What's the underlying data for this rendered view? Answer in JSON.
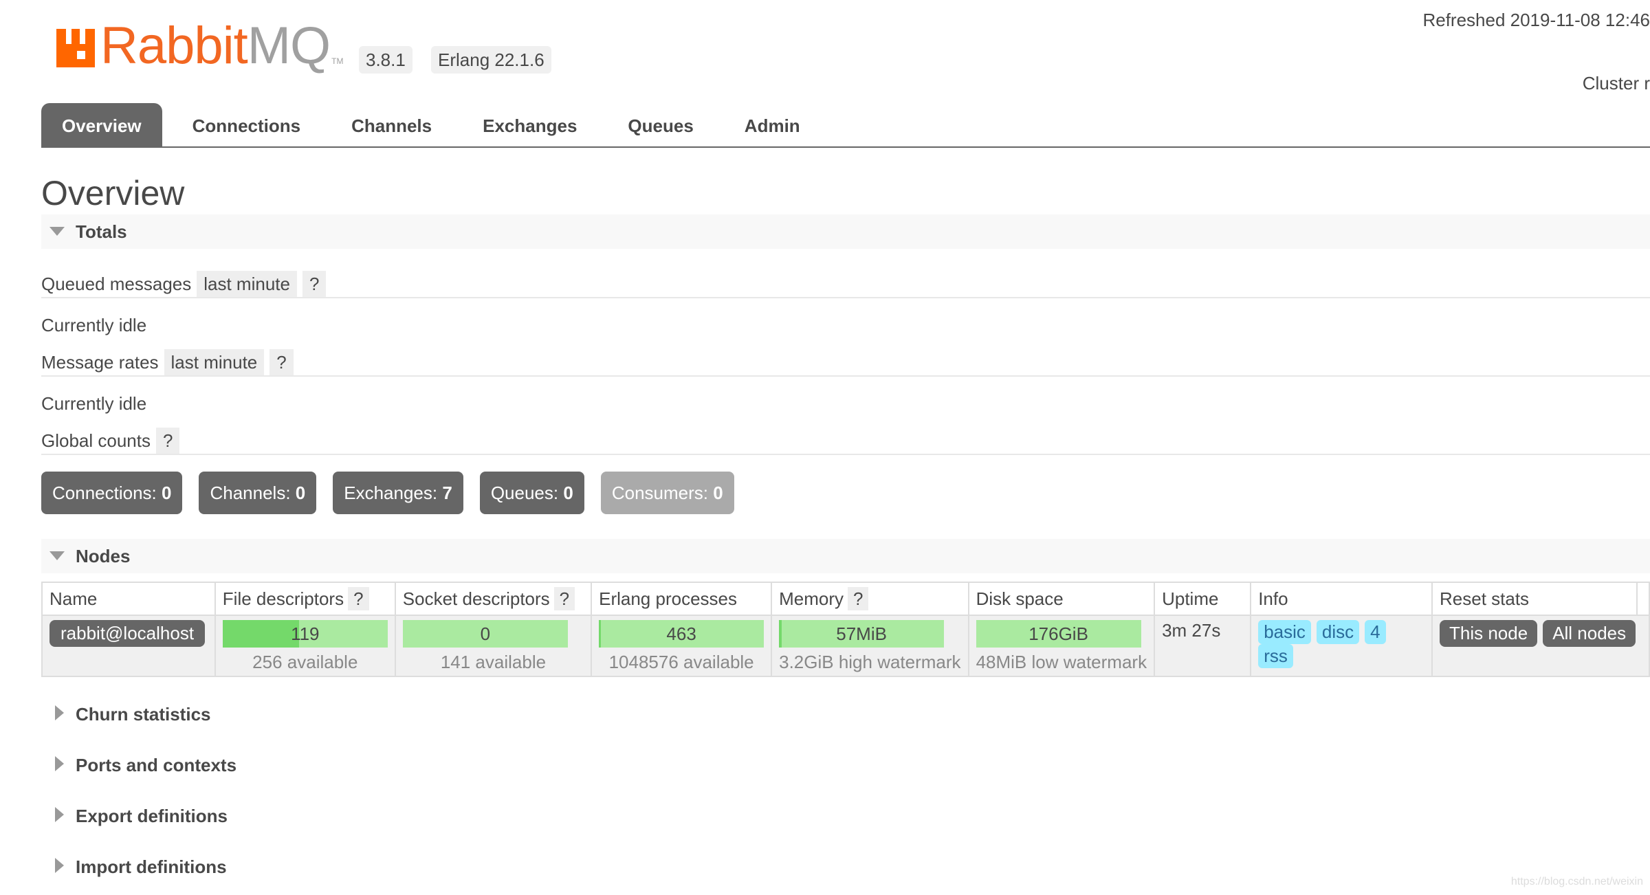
{
  "header": {
    "logo_rabbit": "Rabbit",
    "logo_mq": "MQ",
    "logo_tm": "TM",
    "version": "3.8.1",
    "erlang": "Erlang 22.1.6",
    "refreshed": "Refreshed 2019-11-08 12:46",
    "cluster": "Cluster r"
  },
  "tabs": [
    {
      "label": "Overview",
      "active": true
    },
    {
      "label": "Connections"
    },
    {
      "label": "Channels"
    },
    {
      "label": "Exchanges"
    },
    {
      "label": "Queues"
    },
    {
      "label": "Admin"
    }
  ],
  "page_title": "Overview",
  "totals": {
    "title": "Totals",
    "queued_label": "Queued messages",
    "queued_range": "last minute",
    "help": "?",
    "idle1": "Currently idle",
    "rates_label": "Message rates",
    "rates_range": "last minute",
    "idle2": "Currently idle",
    "global_label": "Global counts",
    "counts": {
      "connections_label": "Connections:",
      "connections": "0",
      "channels_label": "Channels:",
      "channels": "0",
      "exchanges_label": "Exchanges:",
      "exchanges": "7",
      "queues_label": "Queues:",
      "queues": "0",
      "consumers_label": "Consumers:",
      "consumers": "0"
    }
  },
  "nodes": {
    "title": "Nodes",
    "columns": {
      "name": "Name",
      "fd": "File descriptors",
      "sd": "Socket descriptors",
      "ep": "Erlang processes",
      "mem": "Memory",
      "disk": "Disk space",
      "uptime": "Uptime",
      "info": "Info",
      "reset": "Reset stats"
    },
    "row": {
      "name": "rabbit@localhost",
      "fd_value": "119",
      "fd_sub": "256 available",
      "fd_fraction": 0.465,
      "sd_value": "0",
      "sd_sub": "141 available",
      "sd_fraction": 0.0,
      "ep_value": "463",
      "ep_sub": "1048576 available",
      "ep_fraction": 0.0004,
      "mem_value": "57MiB",
      "mem_sub": "3.2GiB high watermark",
      "mem_fraction": 0.017,
      "disk_value": "176GiB",
      "disk_sub": "48MiB low watermark",
      "uptime": "3m 27s",
      "info_tags": [
        "basic",
        "disc",
        "4",
        "rss"
      ],
      "reset_this": "This node",
      "reset_all": "All nodes"
    }
  },
  "collapsed_sections": {
    "churn": "Churn statistics",
    "ports": "Ports and contexts",
    "export": "Export definitions",
    "import": "Import definitions"
  },
  "watermark": "https://blog.csdn.net/weixin",
  "colors": {
    "accent": "#f26722",
    "tab_active": "#666666",
    "bar_bg": "#aaeaa0",
    "bar_fill": "#74d96a",
    "tag_bg": "#99ebff"
  }
}
